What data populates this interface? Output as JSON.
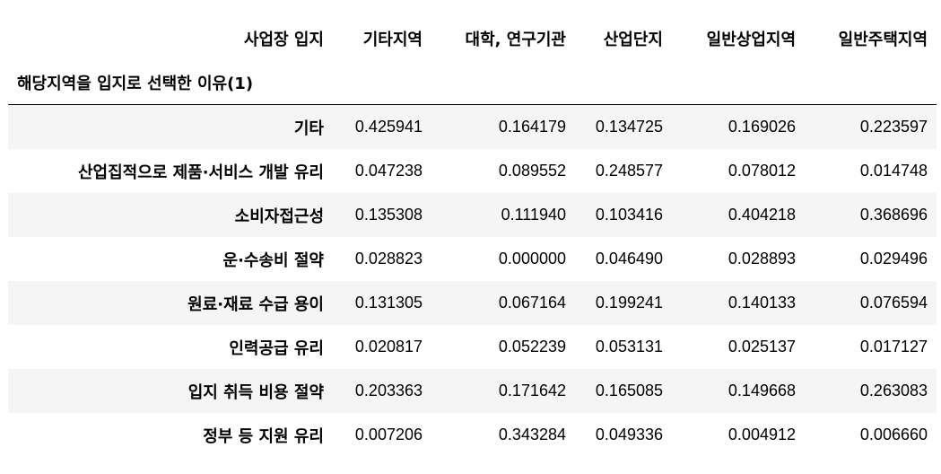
{
  "table": {
    "columns_name": "사업장 입지",
    "index_name": "해당지역을 입지로 선택한 이유(1)",
    "columns": [
      "기타지역",
      "대학, 연구기관",
      "산업단지",
      "일반상업지역",
      "일반주택지역"
    ],
    "rows": [
      {
        "label": "기타",
        "values": [
          "0.425941",
          "0.164179",
          "0.134725",
          "0.169026",
          "0.223597"
        ]
      },
      {
        "label": "산업집적으로 제품·서비스 개발 유리",
        "values": [
          "0.047238",
          "0.089552",
          "0.248577",
          "0.078012",
          "0.014748"
        ]
      },
      {
        "label": "소비자접근성",
        "values": [
          "0.135308",
          "0.111940",
          "0.103416",
          "0.404218",
          "0.368696"
        ]
      },
      {
        "label": "운·수송비 절약",
        "values": [
          "0.028823",
          "0.000000",
          "0.046490",
          "0.028893",
          "0.029496"
        ]
      },
      {
        "label": "원료·재료 수급 용이",
        "values": [
          "0.131305",
          "0.067164",
          "0.199241",
          "0.140133",
          "0.076594"
        ]
      },
      {
        "label": "인력공급 유리",
        "values": [
          "0.020817",
          "0.052239",
          "0.053131",
          "0.025137",
          "0.017127"
        ]
      },
      {
        "label": "입지 취득 비용 절약",
        "values": [
          "0.203363",
          "0.171642",
          "0.165085",
          "0.149668",
          "0.263083"
        ]
      },
      {
        "label": "정부 등 지원 유리",
        "values": [
          "0.007206",
          "0.343284",
          "0.049336",
          "0.004912",
          "0.006660"
        ]
      }
    ]
  }
}
